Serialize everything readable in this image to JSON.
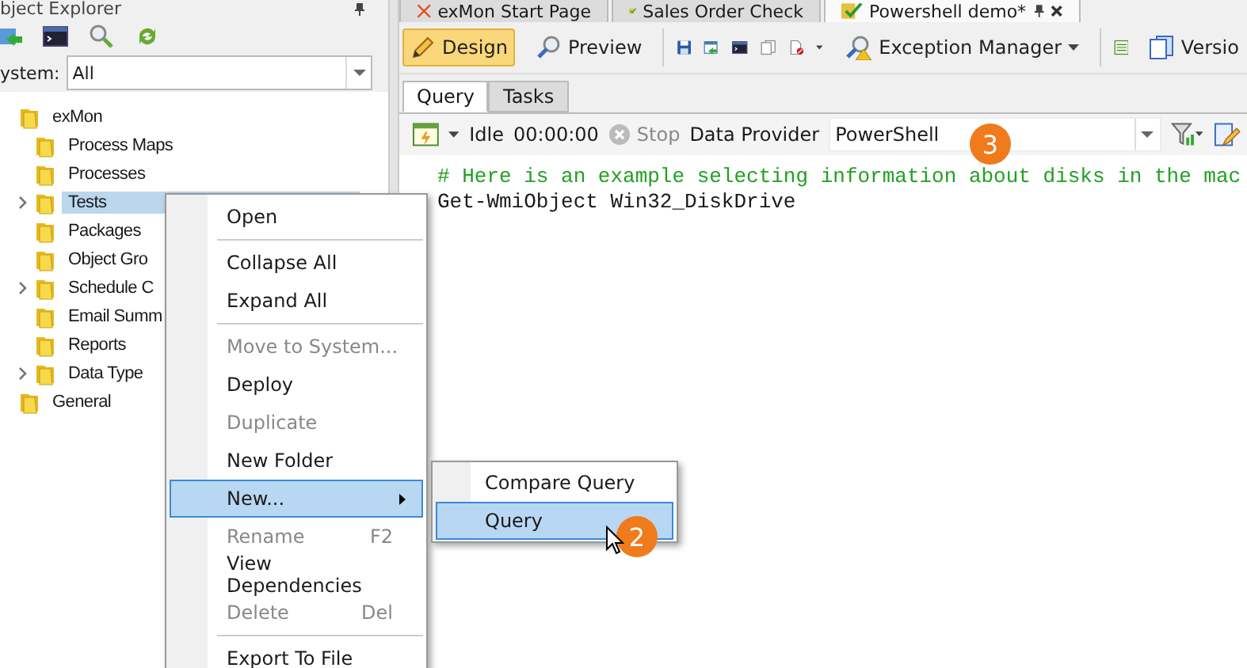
{
  "explorer": {
    "title": "bject Explorer",
    "system_label": "ystem:",
    "system_value": "All",
    "tree": [
      {
        "label": "exMon",
        "expander": false,
        "selected": false,
        "children": [
          {
            "label": "Process Maps",
            "expander": false,
            "selected": false
          },
          {
            "label": "Processes",
            "expander": false,
            "selected": false
          },
          {
            "label": "Tests",
            "expander": true,
            "selected": true
          },
          {
            "label": "Packages",
            "expander": false,
            "selected": false
          },
          {
            "label": "Object Gro",
            "expander": false,
            "selected": false
          },
          {
            "label": "Schedule C",
            "expander": true,
            "selected": false
          },
          {
            "label": "Email Summ",
            "expander": false,
            "selected": false
          },
          {
            "label": "Reports",
            "expander": false,
            "selected": false
          },
          {
            "label": "Data Type",
            "expander": true,
            "selected": false
          }
        ]
      },
      {
        "label": "General",
        "expander": false,
        "selected": false
      }
    ]
  },
  "doc_tabs": [
    {
      "label": "exMon Start Page",
      "selected": false
    },
    {
      "label": "Sales Order Check",
      "selected": false
    },
    {
      "label": "Powershell demo*",
      "selected": true
    }
  ],
  "toolbar": {
    "design": {
      "label": "Design",
      "selected": true
    },
    "preview": {
      "label": "Preview",
      "selected": false
    },
    "exception_manager": "Exception Manager",
    "versions": "Versio"
  },
  "sub_tabs": [
    {
      "label": "Query",
      "selected": true
    },
    {
      "label": "Tasks",
      "selected": false
    }
  ],
  "query_bar": {
    "status": "Idle",
    "time": "00:00:00",
    "stop": "Stop",
    "provider_label": "Data Provider",
    "provider": "PowerShell"
  },
  "editor": {
    "lines": [
      {
        "kind": "comment",
        "text": "# Here is an example selecting information about disks in the mac"
      },
      {
        "kind": "code",
        "text": "Get-WmiObject Win32_DiskDrive"
      }
    ]
  },
  "context_menu": {
    "groups": [
      [
        {
          "label": "Open",
          "disabled": false,
          "selected": false
        }
      ],
      [
        {
          "label": "Collapse All",
          "disabled": false,
          "selected": false
        },
        {
          "label": "Expand All",
          "disabled": false,
          "selected": false
        }
      ],
      [
        {
          "label": "Move to System...",
          "disabled": true,
          "selected": false
        },
        {
          "label": "Deploy",
          "disabled": false,
          "selected": false
        },
        {
          "label": "Duplicate",
          "disabled": true,
          "selected": false
        },
        {
          "label": "New Folder",
          "disabled": false,
          "selected": false
        },
        {
          "label": "New...",
          "disabled": false,
          "selected": true,
          "submenu": true
        },
        {
          "label": "Rename",
          "shortcut": "F2",
          "disabled": true,
          "selected": false
        },
        {
          "label": "View Dependencies",
          "disabled": false,
          "selected": false
        },
        {
          "label": "Delete",
          "shortcut": "Del",
          "disabled": true,
          "selected": false
        }
      ],
      [
        {
          "label": "Export To File",
          "disabled": false,
          "selected": false
        }
      ]
    ]
  },
  "submenu": [
    {
      "label": "Compare Query",
      "selected": false
    },
    {
      "label": "Query",
      "selected": true
    }
  ],
  "callouts": [
    {
      "kind": "query",
      "number": "2"
    },
    {
      "kind": "editor",
      "number": "3"
    }
  ]
}
